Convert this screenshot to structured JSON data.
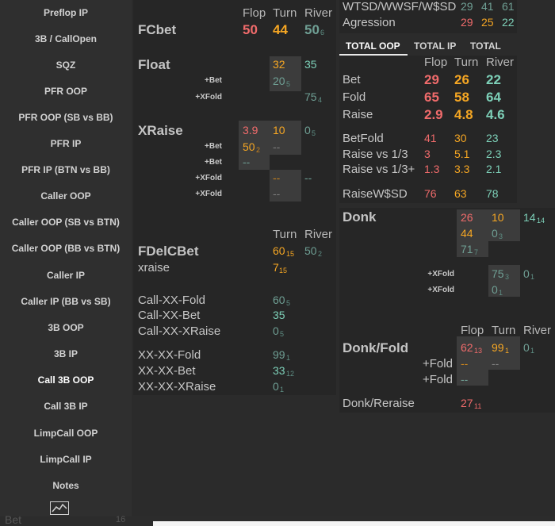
{
  "sidebar": {
    "items": [
      "Preflop IP",
      "3B / CallOpen",
      "SQZ",
      "PFR OOP",
      "PFR OOP (SB vs BB)",
      "PFR IP",
      "PFR IP (BTN vs BB)",
      "Caller OOP",
      "Caller OOP (SB vs BTN)",
      "Caller OOP (BB vs BTN)",
      "Caller IP",
      "Caller IP (BB vs SB)",
      "3B OOP",
      "3B IP",
      "Call 3B OOP",
      "Call 3B IP",
      "LimpCall OOP",
      "LimpCall IP",
      "Notes"
    ],
    "active": "Call 3B OOP",
    "chart_icon": "line-chart-icon"
  },
  "bottom": {
    "label": "Bet",
    "value": "16"
  },
  "col_headers": {
    "flop": "Flop",
    "turn": "Turn",
    "river": "River"
  },
  "fcbet": {
    "title": "FCbet",
    "flop": "50",
    "turn": "44",
    "river": "50",
    "river_n": "6"
  },
  "float": {
    "title": "Float",
    "turn": "32",
    "river": "35",
    "bet_label": "+Bet",
    "bet_turn": "20",
    "bet_turn_n": "5",
    "xfold_label": "+XFold",
    "xfold_river": "75",
    "xfold_river_n": "4"
  },
  "xraise": {
    "title": "XRaise",
    "flop": "3.9",
    "turn": "10",
    "river": "0",
    "river_n": "5",
    "rows": [
      {
        "label": "+Bet",
        "flop": "50",
        "flop_n": "2",
        "turn": "--"
      },
      {
        "label": "+Bet",
        "flop": "--"
      },
      {
        "label": "+XFold",
        "turn": "--",
        "river": "--"
      },
      {
        "label": "+XFold",
        "turn": "--"
      }
    ]
  },
  "fdelcbet": {
    "title": "FDelCBet",
    "turn_hdr": "Turn",
    "river_hdr": "River",
    "turn": "60",
    "turn_n": "15",
    "river": "50",
    "river_n": "2",
    "xraise_label": "xraise",
    "xraise_turn": "7",
    "xraise_turn_n": "15",
    "rows": [
      {
        "label": "Call-XX-Fold",
        "v": "60",
        "n": "5"
      },
      {
        "label": "Call-XX-Bet",
        "v": "35",
        "n": ""
      },
      {
        "label": "Call-XX-XRaise",
        "v": "0",
        "n": "5"
      },
      {
        "label": "XX-XX-Fold",
        "v": "99",
        "n": "1"
      },
      {
        "label": "XX-XX-Bet",
        "v": "33",
        "n": "12"
      },
      {
        "label": "XX-XX-XRaise",
        "v": "0",
        "n": "1"
      }
    ]
  },
  "right_top": {
    "wtsd_label": "WTSD/WWSF/W$SD",
    "wtsd": [
      "29",
      "41",
      "61"
    ],
    "agr_label": "Agression",
    "agr": [
      "29",
      "25",
      "22"
    ]
  },
  "tabs": [
    "TOTAL OOP",
    "TOTAL IP",
    "TOTAL"
  ],
  "total": {
    "hdr": {
      "flop": "Flop",
      "turn": "Turn",
      "river": "River"
    },
    "big_rows": [
      {
        "label": "Bet",
        "v": [
          "29",
          "26",
          "22"
        ]
      },
      {
        "label": "Fold",
        "v": [
          "65",
          "58",
          "64"
        ]
      },
      {
        "label": "Raise",
        "v": [
          "2.9",
          "4.8",
          "4.6"
        ]
      }
    ],
    "rows": [
      {
        "label": "BetFold",
        "v": [
          "41",
          "30",
          "23"
        ]
      },
      {
        "label": "Raise vs 1/3",
        "v": [
          "3",
          "5.1",
          "2.3"
        ]
      },
      {
        "label": "Raise vs 1/3+",
        "v": [
          "1.3",
          "3.3",
          "2.1"
        ]
      }
    ],
    "raisewsd": {
      "label": "RaiseW$SD",
      "v": [
        "76",
        "63",
        "78"
      ]
    }
  },
  "donk": {
    "title": "Donk",
    "r1_flop": "26",
    "r1_turn": "10",
    "r1_river": "14",
    "r1_river_n": "14",
    "r2_flop": "44",
    "r2_turn": "0",
    "r2_turn_n": "3",
    "r3_flop": "71",
    "r3_flop_n": "7",
    "xfold1_label": "+XFold",
    "xfold1_turn": "75",
    "xfold1_turn_n": "3",
    "xfold1_river": "0",
    "xfold1_river_n": "1",
    "xfold2_label": "+XFold",
    "xfold2_turn": "0",
    "xfold2_turn_n": "1"
  },
  "donk_fold": {
    "title": "Donk/Fold",
    "flop": "62",
    "flop_n": "13",
    "turn": "99",
    "turn_n": "1",
    "river": "0",
    "river_n": "1",
    "fold1_label": "+Fold",
    "fold1_flop": "--",
    "fold1_turn": "--",
    "fold2_label": "+Fold",
    "fold2_flop": "--"
  },
  "donk_reraise": {
    "label": "Donk/Reraise",
    "v": "27",
    "n": "11"
  }
}
